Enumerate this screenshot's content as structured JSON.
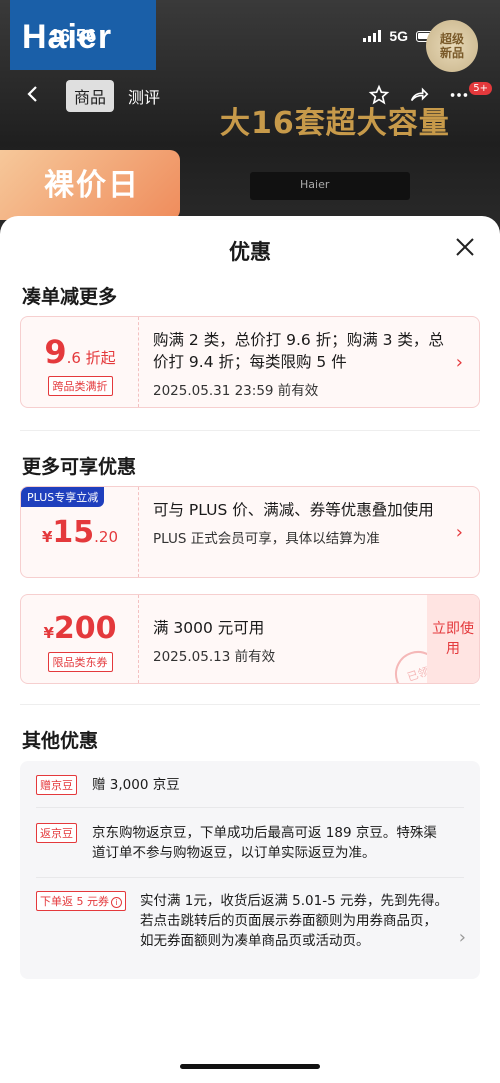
{
  "status": {
    "time": "16:56",
    "network": "5G"
  },
  "background": {
    "brand_logo": "Haier",
    "badge_new": [
      "超级",
      "新品"
    ],
    "tabs": [
      "商品",
      "测评"
    ],
    "cart_count": "5+",
    "headline": "大16套超大容量",
    "promo": "裸价日",
    "device_label": "Haier"
  },
  "sheet": {
    "title": "优惠",
    "sections": {
      "combo": {
        "title": "凑单减更多",
        "card": {
          "big": "9",
          "small": ".6 折起",
          "tag": "跨品类满折",
          "desc": "购满 2 类，总价打 9.6 折；购满 3 类，总价打 9.4 折；每类限购 5 件",
          "validity": "2025.05.31 23:59 前有效"
        }
      },
      "more": {
        "title": "更多可享优惠",
        "plus": {
          "tag": "PLUS专享立减",
          "currency": "¥",
          "amount": "15",
          "decimal": ".20",
          "desc": "可与 PLUS 价、满减、券等优惠叠加使用",
          "note": "PLUS 正式会员可享，具体以结算为准"
        },
        "coupon": {
          "currency": "¥",
          "amount": "200",
          "tag": "限品类东券",
          "desc": "满 3000 元可用",
          "validity": "2025.05.13 前有效",
          "button": "立即使用",
          "stamp": "已领"
        }
      },
      "other": {
        "title": "其他优惠",
        "items": [
          {
            "tag": "赠京豆",
            "text": "赠 3,000 京豆"
          },
          {
            "tag": "返京豆",
            "text": "京东购物返京豆，下单成功后最高可返 189 京豆。特殊渠道订单不参与购物返豆，以订单实际返豆为准。"
          },
          {
            "tag": "下单返 5 元券",
            "text": "实付满 1元，收货后返满 5.01-5 元券，先到先得。若点击跳转后的页面展示券面额则为用券商品页，如无券面额则为凑单商品页或活动页。"
          }
        ]
      }
    }
  },
  "colors": {
    "accent_red": "#e4393c",
    "plus_blue": "#1f3fbd",
    "haier_blue": "#1a5fa8"
  },
  "icons": {
    "back": "chevron-left-icon",
    "favorite": "star-icon",
    "share": "share-icon",
    "more": "more-icon",
    "close": "close-icon",
    "arrow": "chevron-right-icon",
    "info": "info-icon"
  }
}
